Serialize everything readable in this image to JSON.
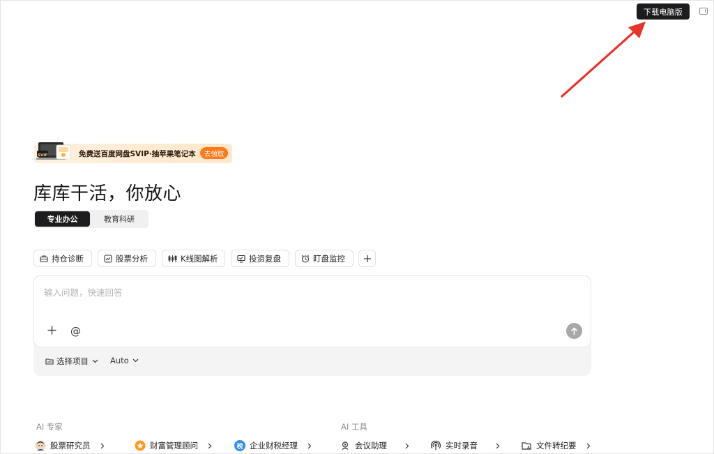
{
  "header": {
    "download_label": "下载电脑版"
  },
  "promo": {
    "text": "免费送百度网盘SVIP·抽苹果笔记本",
    "button": "去领取",
    "badge": "SVIP"
  },
  "headline": "库库干活，你放心",
  "modes": [
    {
      "label": "专业办公",
      "active": true
    },
    {
      "label": "教育科研",
      "active": false
    }
  ],
  "chips": [
    {
      "label": "持仓诊断",
      "icon": "portfolio-icon"
    },
    {
      "label": "股票分析",
      "icon": "chart-icon"
    },
    {
      "label": "K线图解析",
      "icon": "candlestick-icon"
    },
    {
      "label": "投资复盘",
      "icon": "review-icon"
    },
    {
      "label": "盯盘监控",
      "icon": "alarm-icon"
    }
  ],
  "input": {
    "placeholder": "输入问题，快速回答",
    "at_symbol": "@"
  },
  "input_footer": {
    "project_label": "选择项目",
    "model_label": "Auto"
  },
  "sections": {
    "ai_experts": {
      "label": "AI 专家",
      "items": [
        {
          "label": "股票研究员",
          "icon": "researcher-avatar-icon"
        },
        {
          "label": "财富管理顾问",
          "icon": "wealth-advisor-icon"
        },
        {
          "label": "企业财税经理",
          "icon": "tax-manager-icon",
          "glyph": "税"
        }
      ]
    },
    "ai_tools": {
      "label": "AI 工具",
      "items": [
        {
          "label": "会议助理",
          "icon": "meeting-assistant-icon"
        },
        {
          "label": "实时录音",
          "icon": "recording-icon"
        },
        {
          "label": "文件转纪要",
          "icon": "file-to-minutes-icon"
        }
      ]
    }
  },
  "colors": {
    "dark": "#1c1c1e",
    "promo_orange": "#ff7a1a",
    "arrow_red": "#e8332a",
    "send_gray": "#a8a8a8"
  }
}
